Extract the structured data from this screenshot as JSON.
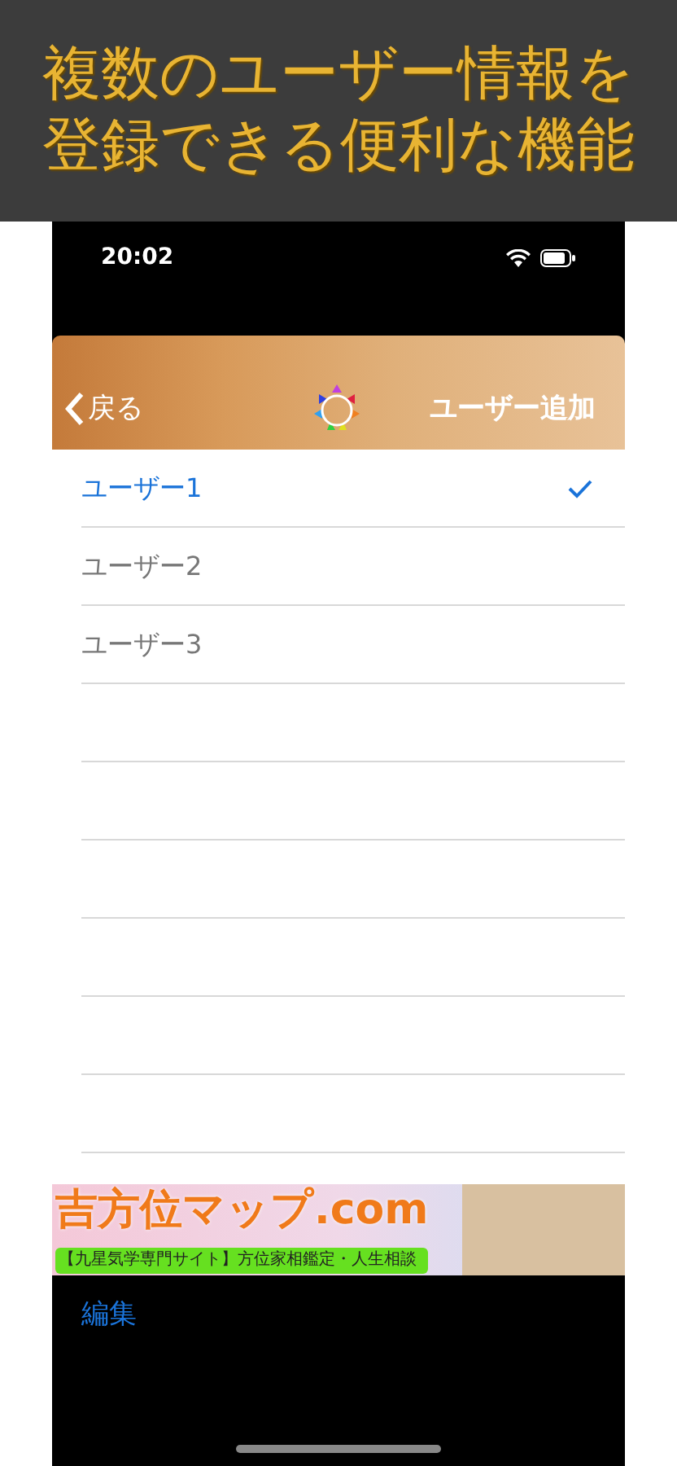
{
  "headline": [
    "複数のユーザー情報を",
    "登録できる便利な機能"
  ],
  "status_bar": {
    "time": "20:02"
  },
  "nav_bar": {
    "back": "戻る",
    "action": "ユーザー追加"
  },
  "users": [
    {
      "name": "ユーザー1",
      "selected": true
    },
    {
      "name": "ユーザー2",
      "selected": false
    },
    {
      "name": "ユーザー3",
      "selected": false
    }
  ],
  "banner": {
    "title": "吉方位マップ.com",
    "subtitle": "【九星気学専門サイト】方位家相鑑定・人生相談"
  },
  "toolbar": {
    "edit": "編集"
  }
}
